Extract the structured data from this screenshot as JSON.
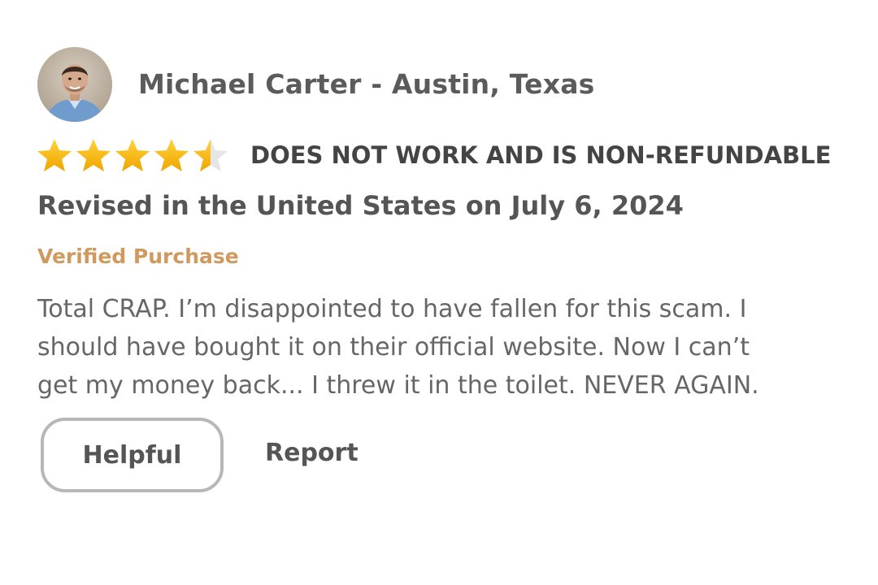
{
  "reviewer": {
    "name": "Michael Carter - Austin, Texas",
    "avatar_icon": "reviewer-avatar-photo"
  },
  "rating": {
    "stars": 4.5,
    "max": 5,
    "star_color": "#f5b50a",
    "empty_star_color": "#e6e6e6"
  },
  "review": {
    "title": "DOES NOT WORK AND IS NON-REFUNDABLE",
    "date": "Revised in the United States on July 6, 2024",
    "verified": "Verified Purchase",
    "body_lines": [
      "Total CRAP. I’m disappointed to have fallen for this scam. I",
      "should have bought it on their official website. Now I can’t",
      "get my money back... I threw it in the toilet. NEVER  AGAIN."
    ]
  },
  "actions": {
    "helpful_label": "Helpful",
    "report_label": "Report"
  },
  "colors": {
    "verified": "#d09a5f",
    "text": "#555555",
    "button_border": "#b7b7b7"
  }
}
